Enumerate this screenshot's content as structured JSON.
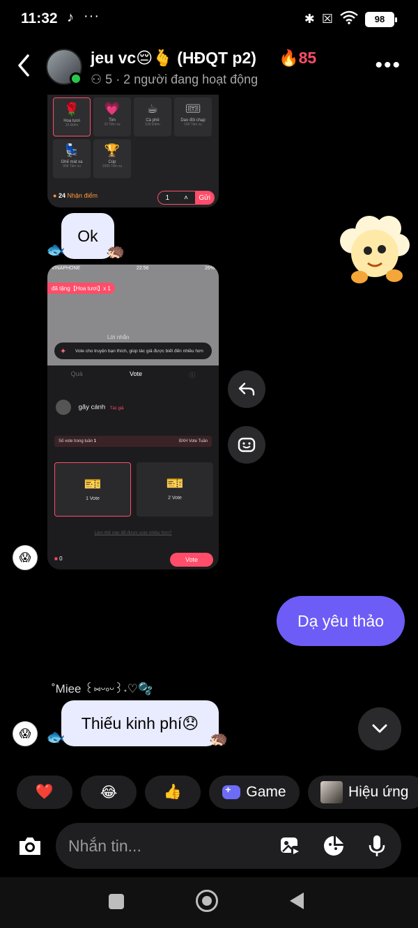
{
  "status_bar": {
    "time": "11:32",
    "tiktok_glyph": "♪",
    "dots": "···",
    "battery": "98",
    "bluetooth": "✱",
    "sim": "☒",
    "wifi": "◔"
  },
  "header": {
    "title": "jeu vc😔🫰 (HĐQT p2)",
    "streak": "🔥85",
    "member_count": "5",
    "active_text": "· 2 người đang hoạt động",
    "more": "•••"
  },
  "card1": {
    "gifts": [
      {
        "icon": "🌹",
        "name": "Hoa tươi",
        "price": "10 Điểm"
      },
      {
        "icon": "💗",
        "name": "Tim",
        "price": "10 Tiền xu"
      },
      {
        "icon": "☕",
        "name": "Cà phê",
        "price": "100 Điểm"
      },
      {
        "icon": "🎟",
        "name": "Dao đôi chạp",
        "price": "199 Tiền xu"
      },
      {
        "icon": "💺",
        "name": "Ghế mát xa",
        "price": "999 Tiền xu"
      },
      {
        "icon": "🏆",
        "name": "Cúp",
        "price": "1999 Tiền xu"
      }
    ],
    "points": "24",
    "points_label": "Nhận điểm",
    "quantity": "1",
    "send": "Gửi"
  },
  "messages": {
    "ok": "Ok",
    "da_yeu_thao": "Dạ yêu thảo",
    "thieu_kinh_phi": "Thiếu kinh phí😞",
    "sender_name": "˚Miee ꒰⑅ᵕ༚ᵕ꒱˖♡🫧"
  },
  "card2": {
    "carrier": "VINAPHONE",
    "time": "22:56",
    "battery": "26%",
    "banner": "đã tặng【Hoa tươi】x 1",
    "note": "Vote cho truyện bạn thích, giúp tác giả được biết đến nhiều hơn",
    "lời_nhắn": "Lời nhắn",
    "tab_gift": "Quà",
    "tab_vote": "Vote",
    "user": "gãy cánh",
    "user_role": "Tác giả",
    "votes_label": "Số vote trong tuần",
    "votes_value": "1",
    "rank_label": "BXH Vote Tuần",
    "vote1": "1 Vote",
    "vote2": "2 Vote",
    "link": "Làm thế nào để được vote nhiều hơn?",
    "count": "0",
    "vote_button": "Vote"
  },
  "quick_reactions": {
    "heart": "❤️",
    "laugh": "😂",
    "thumbs": "👍",
    "game": "Game",
    "effects": "Hiệu ứng"
  },
  "composer": {
    "placeholder": "Nhắn tin..."
  }
}
